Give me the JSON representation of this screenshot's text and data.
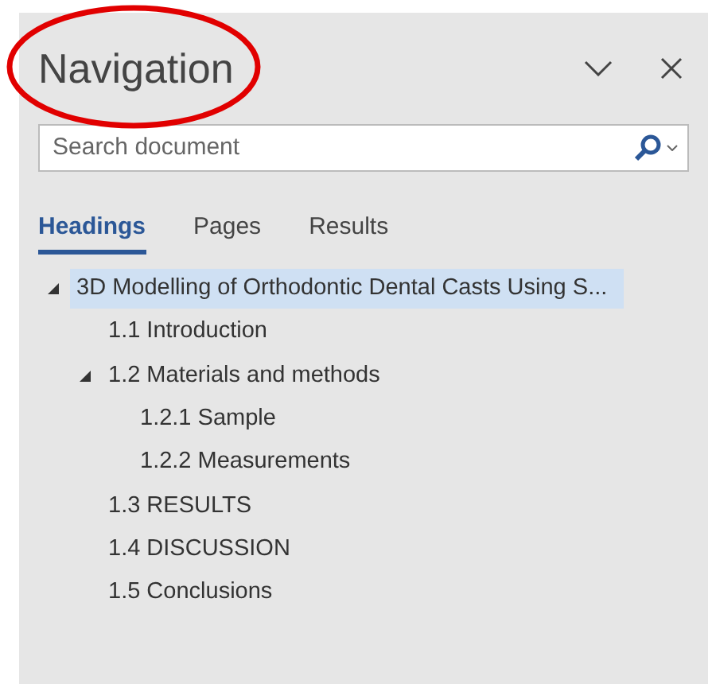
{
  "pane": {
    "title": "Navigation"
  },
  "annotation": {
    "kind": "ellipse"
  },
  "search": {
    "placeholder": "Search document"
  },
  "tabs": [
    {
      "label": "Headings",
      "selected": true
    },
    {
      "label": "Pages",
      "selected": false
    },
    {
      "label": "Results",
      "selected": false
    }
  ],
  "headings": [
    {
      "label": "3D Modelling of Orthodontic Dental Casts Using S...",
      "selected": true,
      "expanded": true,
      "children": [
        {
          "label": "1.1 Introduction",
          "selected": false
        },
        {
          "label": "1.2 Materials and methods",
          "selected": false,
          "expanded": true,
          "children": [
            {
              "label": "1.2.1 Sample",
              "selected": false
            },
            {
              "label": "1.2.2 Measurements",
              "selected": false
            }
          ]
        },
        {
          "label": "1.3 RESULTS",
          "selected": false
        },
        {
          "label": "1.4 DISCUSSION",
          "selected": false
        },
        {
          "label": "1.5 Conclusions",
          "selected": false
        }
      ]
    }
  ]
}
